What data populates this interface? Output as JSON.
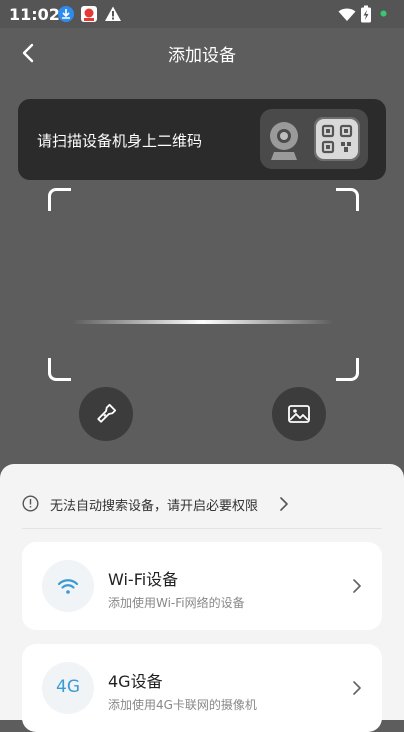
{
  "status_bar": {
    "time": "11:02"
  },
  "header": {
    "title": "添加设备"
  },
  "banner": {
    "text": "请扫描设备机身上二维码"
  },
  "notice": {
    "text": "无法自动搜索设备，请开启必要权限"
  },
  "device_types": [
    {
      "title": "Wi-Fi设备",
      "subtitle": "添加使用Wi-Fi网络的设备",
      "icon": "wifi-icon"
    },
    {
      "title": "4G设备",
      "subtitle": "添加使用4G卡联网的摄像机",
      "icon_text": "4G"
    }
  ],
  "colors": {
    "accent": "#3b9ad4",
    "overlay": "#5d5d5d",
    "sheet": "#f4f4f4"
  }
}
